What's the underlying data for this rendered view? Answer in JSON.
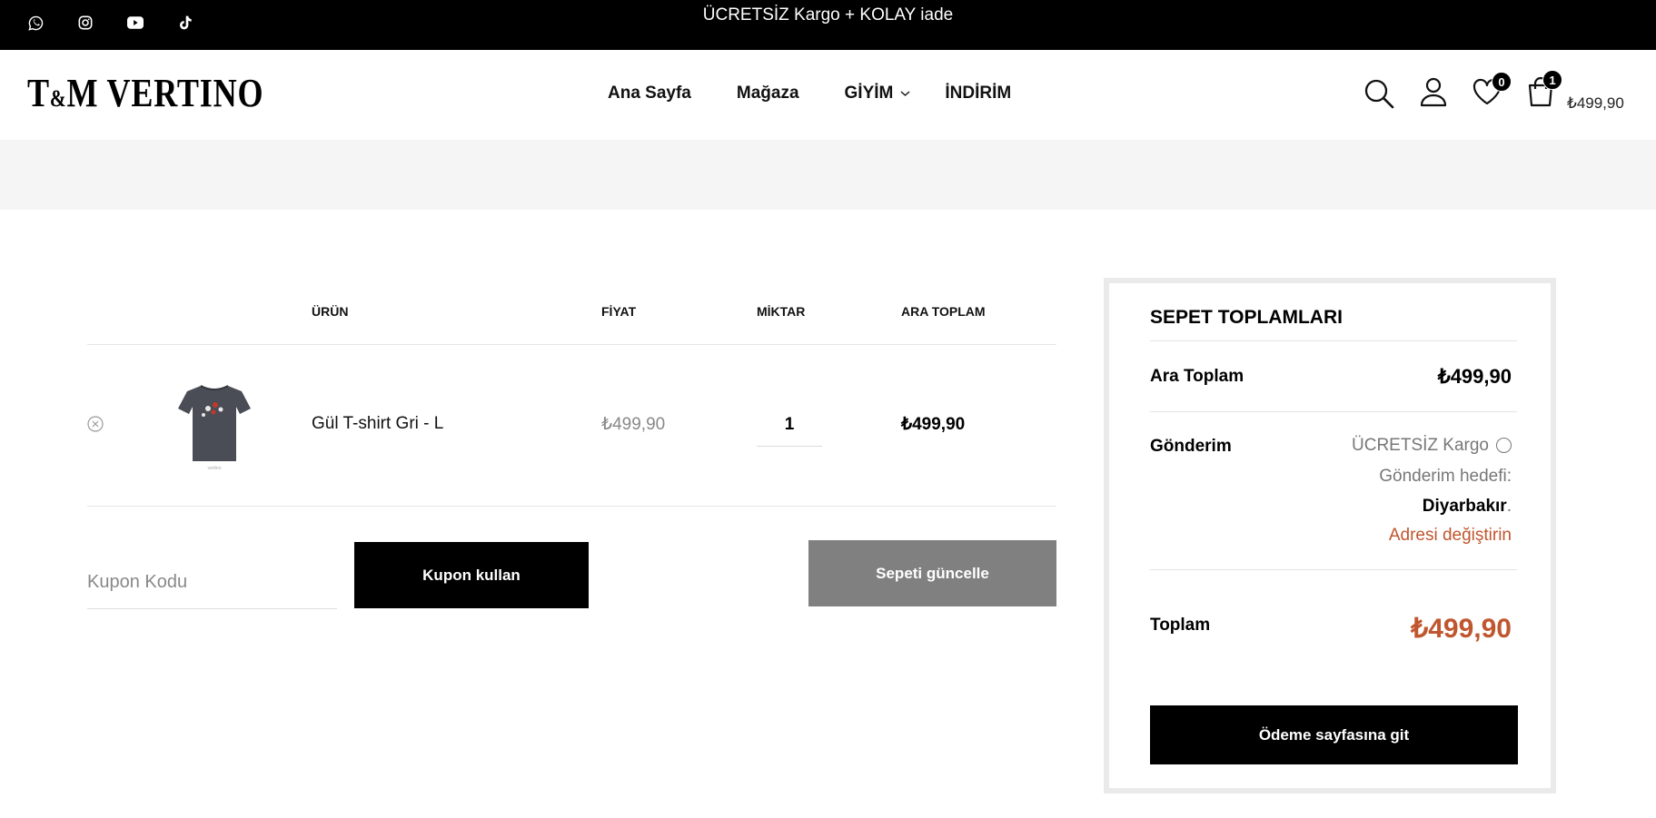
{
  "topbar": {
    "promo": "ÜCRETSİZ Kargo + KOLAY iade",
    "social_icons": [
      "whatsapp-icon",
      "instagram-icon",
      "youtube-icon",
      "tiktok-icon"
    ]
  },
  "header": {
    "logo_main": "T",
    "logo_amp": "&",
    "logo_rest": "M VERTINO",
    "nav": [
      "Ana Sayfa",
      "Mağaza",
      "GİYİM",
      "İNDİRİM"
    ],
    "wishlist_count": "0",
    "cart_count": "1",
    "cart_total": "₺499,90"
  },
  "cart": {
    "columns": {
      "product": "ÜRÜN",
      "price": "FİYAT",
      "quantity": "MİKTAR",
      "subtotal": "ARA TOPLAM"
    },
    "items": [
      {
        "name": "Gül T-shirt Gri - L",
        "price": "₺499,90",
        "quantity": "1",
        "subtotal": "₺499,90"
      }
    ],
    "coupon_placeholder": "Kupon Kodu",
    "apply_coupon": "Kupon kullan",
    "update_cart": "Sepeti güncelle"
  },
  "totals": {
    "title": "SEPET TOPLAMLARI",
    "subtotal_label": "Ara Toplam",
    "subtotal_value": "₺499,90",
    "shipping_label": "Gönderim",
    "shipping_option": "ÜCRETSİZ Kargo",
    "shipping_dest_label": "Gönderim hedefi:",
    "shipping_dest": "Diyarbakır",
    "shipping_dest_suffix": ".",
    "change_address": "Adresi değiştirin",
    "total_label": "Toplam",
    "total_value": "₺499,90",
    "checkout": "Ödeme sayfasına git"
  },
  "colors": {
    "accent": "#c0562f",
    "dark": "#000000",
    "grey_button": "#808080",
    "band": "#f5f5f5"
  }
}
